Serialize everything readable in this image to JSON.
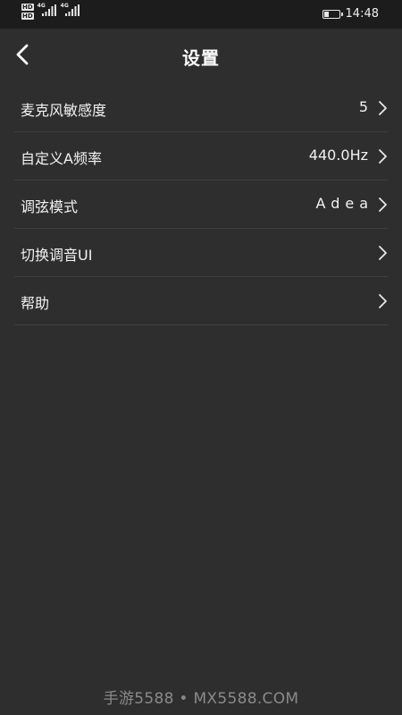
{
  "status_bar": {
    "hd_labels": [
      "HD",
      "HD"
    ],
    "network_labels": [
      "4G",
      "4G"
    ],
    "time": "14:48",
    "icons": [
      "hd-icon",
      "signal-icon",
      "battery-icon"
    ]
  },
  "header": {
    "back_icon": "chevron-left-icon",
    "title": "设置"
  },
  "settings": {
    "items": [
      {
        "label": "麦克风敏感度",
        "value": "5",
        "icon": "chevron-right-icon"
      },
      {
        "label": "自定义A频率",
        "value": "440.0Hz",
        "icon": "chevron-right-icon"
      },
      {
        "label": "调弦模式",
        "value": "Adea",
        "icon": "chevron-right-icon"
      },
      {
        "label": "切换调音UI",
        "value": "",
        "icon": "chevron-right-icon"
      },
      {
        "label": "帮助",
        "value": "",
        "icon": "chevron-right-icon"
      }
    ]
  },
  "watermark": {
    "text": "手游5588 • MX5588.COM"
  },
  "colors": {
    "background": "#2e2e2e",
    "status_bar": "#1c1c1c",
    "divider": "#3f3f3f",
    "text": "#f2f2f2",
    "watermark": "#8a8a8a"
  }
}
